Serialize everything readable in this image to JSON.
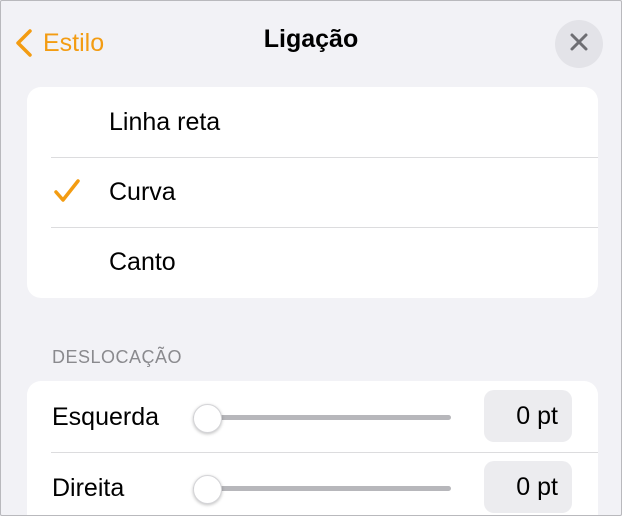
{
  "header": {
    "back_label": "Estilo",
    "title": "Ligação"
  },
  "connection_types": [
    {
      "label": "Linha reta",
      "selected": false
    },
    {
      "label": "Curva",
      "selected": true
    },
    {
      "label": "Canto",
      "selected": false
    }
  ],
  "offset": {
    "section_label": "DESLOCAÇÃO",
    "rows": [
      {
        "label": "Esquerda",
        "value": "0 pt",
        "slider_fraction": 0
      },
      {
        "label": "Direita",
        "value": "0 pt",
        "slider_fraction": 0
      }
    ]
  },
  "colors": {
    "accent": "#f39c12",
    "background": "#f2f2f6",
    "card": "#ffffff"
  },
  "icons": {
    "back": "chevron-left-icon",
    "close": "close-icon",
    "check": "checkmark-icon"
  }
}
